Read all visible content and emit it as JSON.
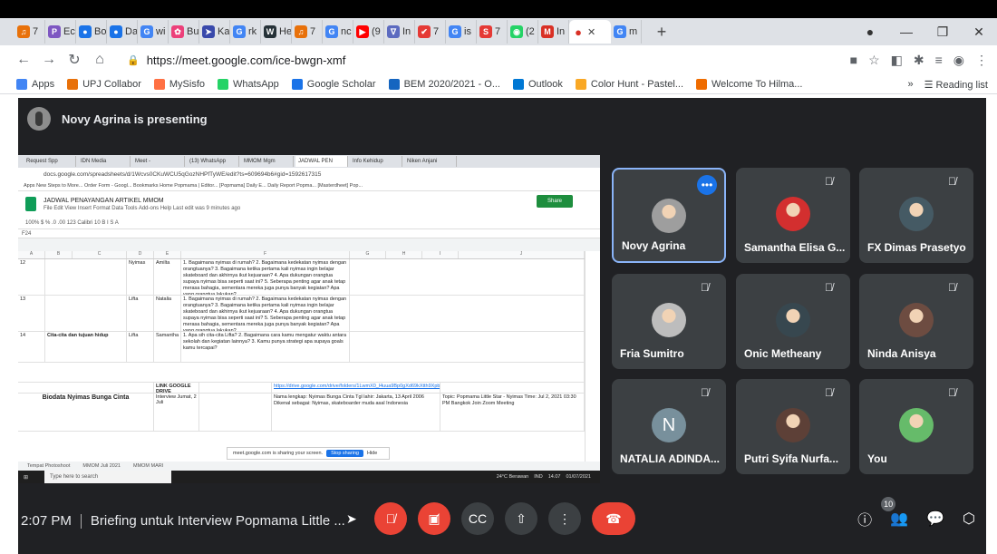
{
  "browser": {
    "tabs": [
      {
        "label": "7",
        "color": "#e8710a",
        "glyph": "♫"
      },
      {
        "label": "Ec",
        "color": "#7e57c2",
        "glyph": "P"
      },
      {
        "label": "Bo",
        "color": "#1a73e8",
        "glyph": "●"
      },
      {
        "label": "Da",
        "color": "#1a73e8",
        "glyph": "●"
      },
      {
        "label": "wi",
        "color": "#4285f4",
        "glyph": "G"
      },
      {
        "label": "Bu",
        "color": "#ec407a",
        "glyph": "✿"
      },
      {
        "label": "Ka",
        "color": "#3949ab",
        "glyph": "➤"
      },
      {
        "label": "rk",
        "color": "#4285f4",
        "glyph": "G"
      },
      {
        "label": "He",
        "color": "#263238",
        "glyph": "W"
      },
      {
        "label": "7",
        "color": "#e8710a",
        "glyph": "♫"
      },
      {
        "label": "nc",
        "color": "#4285f4",
        "glyph": "G"
      },
      {
        "label": "(9",
        "color": "#ff0000",
        "glyph": "▶"
      },
      {
        "label": "In",
        "color": "#5c6bc0",
        "glyph": "∇"
      },
      {
        "label": "7",
        "color": "#e53935",
        "glyph": "✔"
      },
      {
        "label": "is",
        "color": "#4285f4",
        "glyph": "G"
      },
      {
        "label": "7",
        "color": "#e53935",
        "glyph": "S"
      },
      {
        "label": "(2",
        "color": "#25d366",
        "glyph": "◉"
      },
      {
        "label": "In",
        "color": "#d93025",
        "glyph": "M"
      }
    ],
    "active_tab": {
      "glyph": "●",
      "color": "#d93025"
    },
    "last_tab": {
      "label": "m",
      "glyph": "G"
    },
    "new_tab": "+",
    "url": "https://meet.google.com/ice-bwgn-xmf",
    "bookmarks": [
      {
        "label": "Apps",
        "color": "#4285f4"
      },
      {
        "label": "UPJ Collabor",
        "color": "#e8710a"
      },
      {
        "label": "MySisfo",
        "color": "#ff7043"
      },
      {
        "label": "WhatsApp",
        "color": "#25d366"
      },
      {
        "label": "Google Scholar",
        "color": "#1a73e8"
      },
      {
        "label": "BEM 2020/2021 - O...",
        "color": "#1565c0"
      },
      {
        "label": "Outlook",
        "color": "#0078d4"
      },
      {
        "label": "Color Hunt - Pastel...",
        "color": "#f9a825"
      },
      {
        "label": "Welcome To Hilma...",
        "color": "#ef6c00"
      }
    ],
    "reading_list": "Reading list"
  },
  "meet": {
    "presenter_text": "Novy Agrina is presenting",
    "time": "2:07 PM",
    "meeting_title": "Briefing untuk Interview Popmama Little ...",
    "people_count": "10",
    "participants": [
      {
        "name": "Novy Agrina",
        "muted": false,
        "speaking": true,
        "avatar": "photo",
        "color": "#9e9e9e"
      },
      {
        "name": "Samantha Elisa G...",
        "muted": true,
        "speaking": false,
        "avatar": "photo",
        "color": "#d32f2f"
      },
      {
        "name": "FX Dimas Prasetyo",
        "muted": true,
        "speaking": false,
        "avatar": "photo",
        "color": "#455a64"
      },
      {
        "name": "Fria Sumitro",
        "muted": true,
        "speaking": false,
        "avatar": "photo",
        "color": "#bdbdbd"
      },
      {
        "name": "Onic Metheany",
        "muted": true,
        "speaking": false,
        "avatar": "photo",
        "color": "#37474f"
      },
      {
        "name": "Ninda Anisya",
        "muted": true,
        "speaking": false,
        "avatar": "photo",
        "color": "#6d4c41"
      },
      {
        "name": "NATALIA ADINDA...",
        "muted": true,
        "speaking": false,
        "avatar": "N",
        "color": "#78909c"
      },
      {
        "name": "Putri Syifa Nurfa...",
        "muted": true,
        "speaking": false,
        "avatar": "photo",
        "color": "#5d4037"
      },
      {
        "name": "You",
        "muted": true,
        "speaking": false,
        "avatar": "photo",
        "color": "#66bb6a"
      }
    ]
  },
  "shared_screen": {
    "tabs": [
      "Request Spp",
      "IDN Media",
      "Meet -",
      "(13) WhatsApp",
      "MMOM Mgm",
      "JADWAL PEN",
      "Info Kehidup",
      "Niken Anjani"
    ],
    "url": "docs.google.com/spreadsheets/d/1Wcvs0CKuWCU5qGozNHPfTyWE/edit?ts=609694b6#gid=1592617315",
    "bookmarks": "Apps  New Steps to More...  Order Form - Googl...  Bookmarks  Home  Popmama | Editor...  [Popmama] Daily E...  Daily Report Popma...  [Masterdheet] Pop...",
    "doc_title": "JADWAL PENAYANGAN ARTIKEL MMOM",
    "doc_menu": "File  Edit  View  Insert  Format  Data  Tools  Add-ons  Help   Last edit was 9 minutes ago",
    "share_btn": "Share",
    "toolbar": "100%  $  %  .0  .00  123  Calibri  10  B  I  S  A",
    "cell_ref": "F24",
    "col_letters": [
      "A",
      "B",
      "C",
      "D",
      "E",
      "F",
      "G",
      "H",
      "I",
      "J"
    ],
    "rows": [
      {
        "num": "12",
        "topic": "",
        "writer": "Nyimas",
        "editor": "Amilta",
        "q": "1. Bagaimana nyimas di rumah? 2. Bagaimana kedekatan nyimas dengan orangtuanya? 3. Bagaimana ketika pertama kali nyimas ingin belajar skateboard dan akhirnya ikut kejuaraan? 4. Apa dukungan orangtua supaya nyimas bisa seperti saat ini? 5. Seberapa penting agar anak tetap merasa bahagia, sementara mereka juga punya banyak kegiatan? Apa yang orangtua lakukan?"
      },
      {
        "num": "13",
        "topic": "",
        "writer": "Lifta",
        "editor": "Natalia",
        "q": "1. Bagaimana nyimas di rumah? 2. Bagaimana kedekatan nyimas dengan orangtuanya? 3. Bagaimana ketika pertama kali nyimas ingin belajar skateboard dan akhirnya ikut kejuaraan? 4. Apa dukungan orangtua supaya nyimas bisa seperti saat ini? 5. Seberapa penting agar anak tetap merasa bahagia, sementara mereka juga punya banyak kegiatan? Apa yang orangtua lakukan?"
      },
      {
        "num": "14",
        "topic": "Cita-cita dan tujuan hidup",
        "writer": "Lifta",
        "editor": "Samantha",
        "q": "1. Apa sih cita-cita Lifta? 2. Bagaimana cara kamu mengatur waktu antara sekolah dan kegiatan lainnya? 3. Kamu punya strategi apa supaya goals kamu tercapai?"
      }
    ],
    "link_label": "LINK GOOGLE DRIVE",
    "link_url": "https://drive.google.com/drive/folders/1LwmX0_l4uua9Bp0gXd69kXtth9Xpb94m",
    "bio_title": "Biodata Nyimas Bunga Cinta",
    "bio_text": "Nama lengkap: Nyimas Bunga Cinta  Tgl lahir: Jakarta, 13 April 2006  Dikenal sebagai: Nyimas, skateboarder muda asal Indonesia",
    "interview": "Interview Jumat, 2 Juli",
    "topic_right": "Topic: Popmama Little Star - Nyimas  Time: Jul 2, 2021 03:30 PM Bangkok  Join Zoom Meeting",
    "notif_text": "meet.google.com is sharing your screen.",
    "notif_stop": "Stop sharing",
    "notif_hide": "Hide",
    "sheet_tabs": [
      "Tempat Photoshoot",
      "MMOM Juli 2021",
      "MMOM MARI"
    ],
    "taskbar_search": "Type here to search",
    "tray": [
      "24°C Berawan",
      "IND",
      "14.07",
      "01/07/2021"
    ]
  }
}
